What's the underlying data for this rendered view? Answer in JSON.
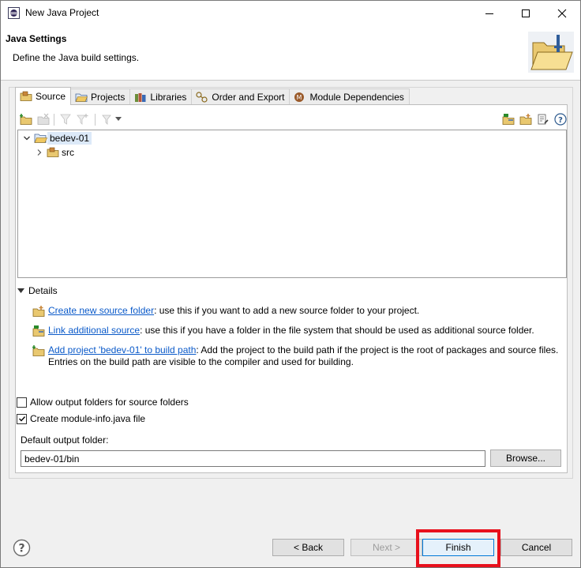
{
  "window": {
    "title": "New Java Project"
  },
  "header": {
    "title": "Java Settings",
    "description": "Define the Java build settings."
  },
  "tabs": [
    {
      "label": "Source",
      "icon": "source-folder-icon",
      "active": true
    },
    {
      "label": "Projects",
      "icon": "projects-icon",
      "active": false
    },
    {
      "label": "Libraries",
      "icon": "libraries-icon",
      "active": false
    },
    {
      "label": "Order and Export",
      "icon": "order-export-icon",
      "active": false
    },
    {
      "label": "Module Dependencies",
      "icon": "module-icon",
      "active": false
    }
  ],
  "tree": {
    "project": {
      "label": "bedev-01",
      "expanded": true,
      "selected": true
    },
    "children": [
      {
        "label": "src",
        "expanded": false
      }
    ]
  },
  "details": {
    "label": "Details",
    "items": [
      {
        "link": "Create new source folder",
        "text": ": use this if you want to add a new source folder to your project."
      },
      {
        "link": "Link additional source",
        "text": ": use this if you have a folder in the file system that should be used as additional source folder."
      },
      {
        "link": "Add project 'bedev-01' to build path",
        "text": ": Add the project to the build path if the project is the root of packages and source files. Entries on the build path are visible to the compiler and used for building."
      }
    ]
  },
  "options": {
    "allow_output": {
      "label": "Allow output folders for source folders",
      "checked": false
    },
    "module_info": {
      "label": "Create module-info.java file",
      "checked": true
    }
  },
  "output": {
    "label": "Default output folder:",
    "value": "bedev-01/bin",
    "browse_label": "Browse..."
  },
  "buttons": {
    "back": "< Back",
    "next": "Next >",
    "finish": "Finish",
    "cancel": "Cancel"
  },
  "colors": {
    "link": "#0b5ac9",
    "highlight": "#e8101c",
    "finish_border": "#0078d7"
  }
}
